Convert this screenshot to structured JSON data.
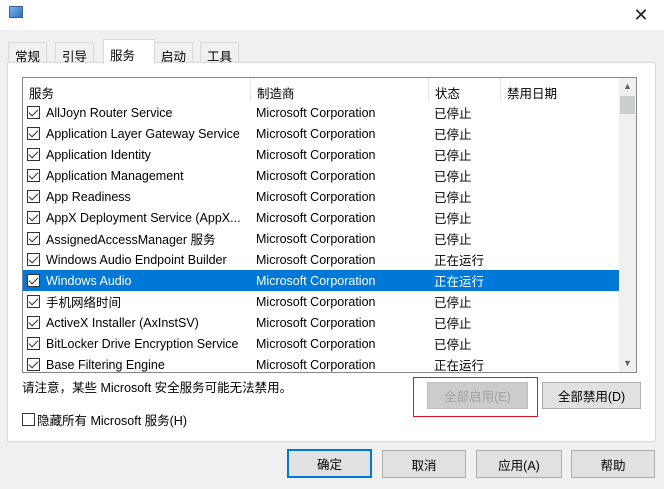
{
  "window": {
    "close": "✕"
  },
  "tabs": [
    "常规",
    "引导",
    "服务",
    "启动",
    "工具"
  ],
  "columns": [
    "服务",
    "制造商",
    "状态",
    "禁用日期"
  ],
  "rows": [
    {
      "name": "AllJoyn Router Service",
      "maker": "Microsoft Corporation",
      "status": "已停止",
      "checked": true
    },
    {
      "name": "Application Layer Gateway Service",
      "maker": "Microsoft Corporation",
      "status": "已停止",
      "checked": true
    },
    {
      "name": "Application Identity",
      "maker": "Microsoft Corporation",
      "status": "已停止",
      "checked": true
    },
    {
      "name": "Application Management",
      "maker": "Microsoft Corporation",
      "status": "已停止",
      "checked": true
    },
    {
      "name": "App Readiness",
      "maker": "Microsoft Corporation",
      "status": "已停止",
      "checked": true
    },
    {
      "name": "AppX Deployment Service (AppX...",
      "maker": "Microsoft Corporation",
      "status": "已停止",
      "checked": true
    },
    {
      "name": "AssignedAccessManager 服务",
      "maker": "Microsoft Corporation",
      "status": "已停止",
      "checked": true
    },
    {
      "name": "Windows Audio Endpoint Builder",
      "maker": "Microsoft Corporation",
      "status": "正在运行",
      "checked": true
    },
    {
      "name": "Windows Audio",
      "maker": "Microsoft Corporation",
      "status": "正在运行",
      "checked": true,
      "selected": true
    },
    {
      "name": "手机网络时间",
      "maker": "Microsoft Corporation",
      "status": "已停止",
      "checked": true
    },
    {
      "name": "ActiveX Installer (AxInstSV)",
      "maker": "Microsoft Corporation",
      "status": "已停止",
      "checked": true
    },
    {
      "name": "BitLocker Drive Encryption Service",
      "maker": "Microsoft Corporation",
      "status": "已停止",
      "checked": true
    },
    {
      "name": "Base Filtering Engine",
      "maker": "Microsoft Corporation",
      "status": "正在运行",
      "checked": true
    }
  ],
  "note": "请注意，某些 Microsoft 安全服务可能无法禁用。",
  "enable_all": "全部启用(E)",
  "disable_all": "全部禁用(D)",
  "hide_ms": "隐藏所有 Microsoft 服务(H)",
  "buttons": {
    "ok": "确定",
    "cancel": "取消",
    "apply": "应用(A)",
    "help": "帮助"
  }
}
